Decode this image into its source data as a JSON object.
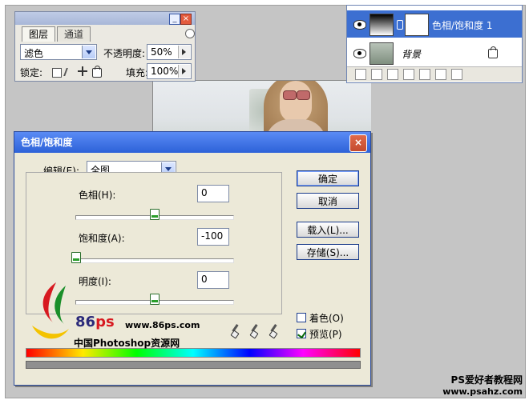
{
  "layers_mini_panel": {
    "tabs": [
      "图层",
      "通道"
    ],
    "blend_mode": "滤色",
    "opacity_label": "不透明度:",
    "opacity_value": "50%",
    "lock_label": "锁定:",
    "fill_label": "填充:",
    "fill_value": "100%"
  },
  "layers_panel": {
    "layers": [
      {
        "name": "色相/饱和度 1",
        "selected": true,
        "visible": true
      },
      {
        "name": "背景",
        "selected": false,
        "visible": true,
        "locked": true
      }
    ]
  },
  "dialog": {
    "title": "色相/饱和度",
    "edit_label": "编辑(E):",
    "edit_value": "全图",
    "hue_label": "色相(H):",
    "hue_value": "0",
    "saturation_label": "饱和度(A):",
    "saturation_value": "-100",
    "lightness_label": "明度(I):",
    "lightness_value": "0",
    "buttons": {
      "ok": "确定",
      "cancel": "取消",
      "load": "载入(L)...",
      "save": "存储(S)..."
    },
    "colorize_label": "着色(O)",
    "colorize_checked": false,
    "preview_label": "预览(P)",
    "preview_checked": true,
    "sliders": {
      "hue": {
        "min": -180,
        "max": 180,
        "value": 0
      },
      "saturation": {
        "min": -100,
        "max": 100,
        "value": -100
      },
      "lightness": {
        "min": -100,
        "max": 100,
        "value": 0
      }
    }
  },
  "logo": {
    "brand_number": "86",
    "brand_letters": "ps",
    "url": "www.86ps.com",
    "caption": "中国Photoshop资源网"
  },
  "watermark": {
    "line1": "PS爱好者教程网",
    "line2": "www.psahz.com"
  },
  "colors": {
    "dialog_title_blue": "#2d62d8",
    "selected_layer_blue": "#3c6fd1",
    "panel_beige": "#ece9d8"
  },
  "icons": {
    "eye": "eye-icon",
    "lock": "lock-icon",
    "close": "close-icon",
    "dropdown": "chevron-down-icon",
    "eyedropper": "eyedropper-icon"
  }
}
